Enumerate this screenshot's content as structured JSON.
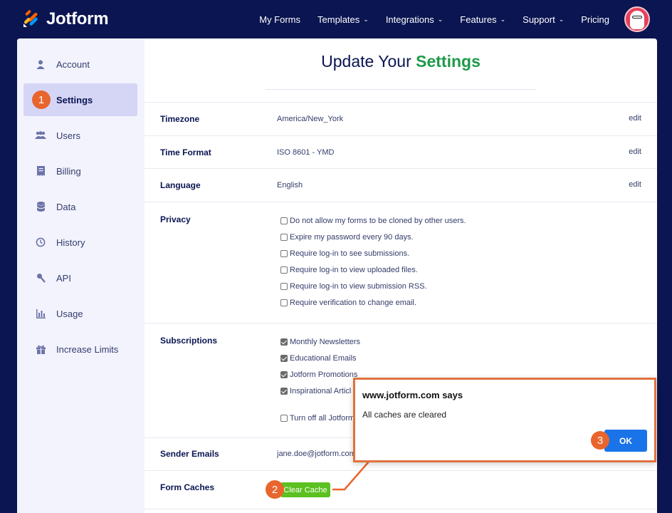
{
  "topnav": {
    "logo_text": "Jotform",
    "items": [
      {
        "label": "My Forms",
        "chevron": false
      },
      {
        "label": "Templates",
        "chevron": true
      },
      {
        "label": "Integrations",
        "chevron": true
      },
      {
        "label": "Features",
        "chevron": true
      },
      {
        "label": "Support",
        "chevron": true
      },
      {
        "label": "Pricing",
        "chevron": false
      }
    ],
    "chevron_glyph": "⌄"
  },
  "sidebar": {
    "items": [
      {
        "label": "Account",
        "icon": "user-icon"
      },
      {
        "label": "Settings",
        "icon": "gear-icon",
        "active": true
      },
      {
        "label": "Users",
        "icon": "users-icon"
      },
      {
        "label": "Billing",
        "icon": "receipt-icon"
      },
      {
        "label": "Data",
        "icon": "database-icon"
      },
      {
        "label": "History",
        "icon": "history-icon"
      },
      {
        "label": "API",
        "icon": "api-icon"
      },
      {
        "label": "Usage",
        "icon": "bar-chart-icon"
      },
      {
        "label": "Increase Limits",
        "icon": "gift-icon"
      }
    ]
  },
  "main": {
    "title_prefix": "Update Your ",
    "title_accent": "Settings",
    "rows": {
      "timezone": {
        "label": "Timezone",
        "value": "America/New_York",
        "edit": "edit"
      },
      "time_format": {
        "label": "Time Format",
        "value": "ISO 8601 - YMD",
        "edit": "edit"
      },
      "language": {
        "label": "Language",
        "value": "English",
        "edit": "edit"
      },
      "privacy": {
        "label": "Privacy",
        "options": [
          {
            "text": "Do not allow my forms to be cloned by other users.",
            "checked": false
          },
          {
            "text": "Expire my password every 90 days.",
            "checked": false
          },
          {
            "text": "Require log-in to see submissions.",
            "checked": false
          },
          {
            "text": "Require log-in to view uploaded files.",
            "checked": false
          },
          {
            "text": "Require log-in to view submission RSS.",
            "checked": false
          },
          {
            "text": "Require verification to change email.",
            "checked": false
          }
        ]
      },
      "subscriptions": {
        "label": "Subscriptions",
        "options": [
          {
            "text": "Monthly Newsletters",
            "checked": true
          },
          {
            "text": "Educational Emails",
            "checked": true
          },
          {
            "text": "Jotform Promotions",
            "checked": true
          },
          {
            "text": "Inspirational Articl",
            "checked": true
          }
        ],
        "turn_off": {
          "text": "Turn off all Jotform",
          "checked": false
        }
      },
      "sender_emails": {
        "label": "Sender Emails",
        "value": "jane.doe@jotform.com"
      },
      "form_caches": {
        "label": "Form Caches",
        "button": "Clear Cache"
      }
    }
  },
  "dialog": {
    "title": "www.jotform.com says",
    "message": "All caches are cleared",
    "ok_label": "OK"
  },
  "badges": {
    "one": "1",
    "two": "2",
    "three": "3"
  },
  "colors": {
    "nav_bg": "#0a1551",
    "accent_green": "#1f9a49",
    "sidebar_active": "#d5d6f6",
    "callout_orange": "#e8652d",
    "ok_blue": "#1a73e8",
    "clear_green": "#5bc020"
  }
}
